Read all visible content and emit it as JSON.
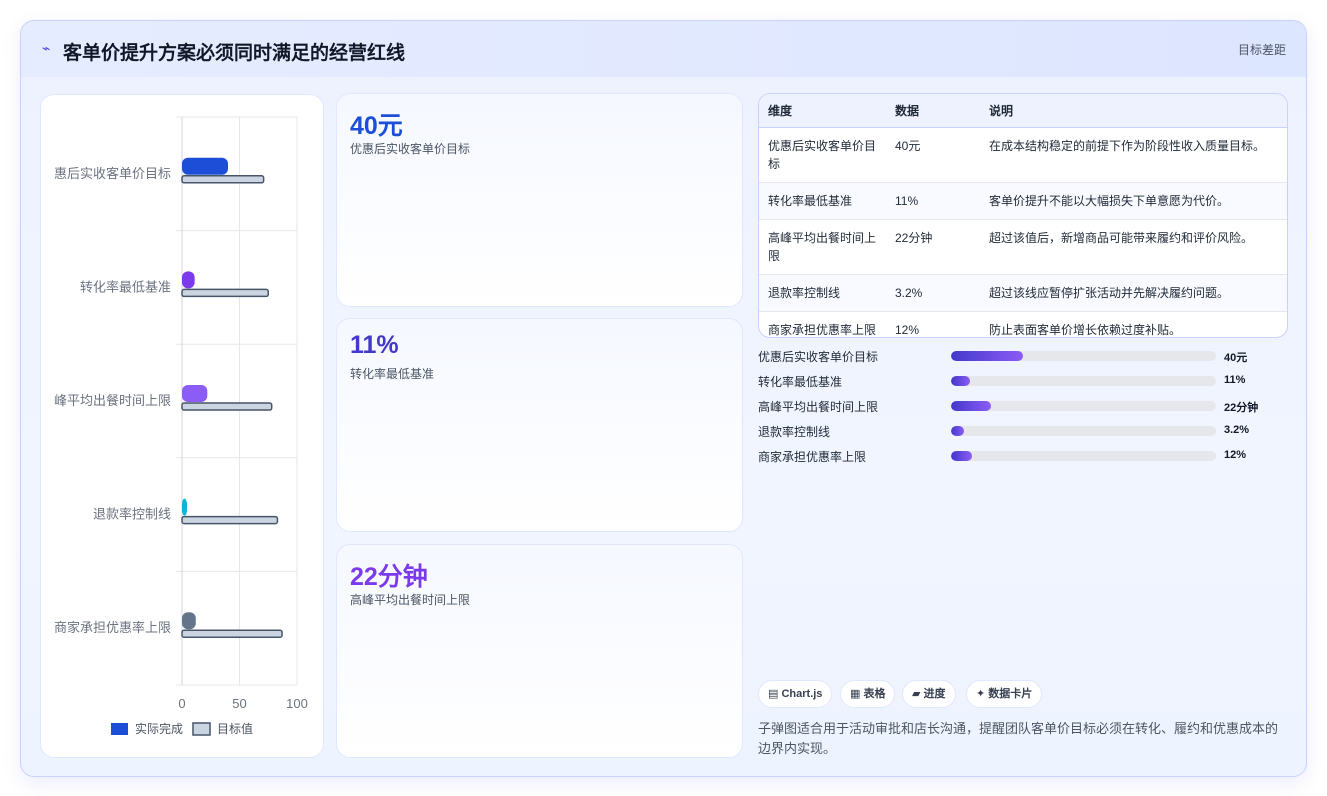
{
  "header": {
    "title": "客单价提升方案必须同时满足的经营红线",
    "tag": "目标差距"
  },
  "colors": {
    "accent": "#4f46e5",
    "blue": "#1d4ed8",
    "violet": "#7c3aed",
    "purple": "#8b5cf6",
    "cyan": "#06b6d4",
    "slate": "#64748b",
    "target": "#cbd5e1"
  },
  "chart_data": {
    "type": "bar",
    "orientation": "horizontal",
    "categories": [
      "惠后实收客单价目标",
      "转化率最低基准",
      "峰平均出餐时间上限",
      "退款率控制线",
      "商家承担优惠率上限"
    ],
    "series": [
      {
        "name": "实际完成",
        "values": [
          40,
          11,
          22,
          3.2,
          12
        ]
      },
      {
        "name": "目标值",
        "values": [
          71,
          75,
          78,
          83,
          87
        ]
      }
    ],
    "xlim": [
      0,
      100
    ],
    "xticks": [
      "0",
      "50",
      "100"
    ],
    "grid": true,
    "legend": "bottom"
  },
  "stats": [
    {
      "value": "40元",
      "label": "优惠后实收客单价目标",
      "color": "#1d4ed8"
    },
    {
      "value": "11%",
      "label": "转化率最低基准",
      "color": "#4338ca"
    },
    {
      "value": "22分钟",
      "label": "高峰平均出餐时间上限",
      "color": "#7c3aed"
    }
  ],
  "table": {
    "headers": [
      "维度",
      "数据",
      "说明"
    ],
    "rows": [
      [
        "优惠后实收客单价目标",
        "40元",
        "在成本结构稳定的前提下作为阶段性收入质量目标。"
      ],
      [
        "转化率最低基准",
        "11%",
        "客单价提升不能以大幅损失下单意愿为代价。"
      ],
      [
        "高峰平均出餐时间上限",
        "22分钟",
        "超过该值后，新增商品可能带来履约和评价风险。"
      ],
      [
        "退款率控制线",
        "3.2%",
        "超过该线应暂停扩张活动并先解决履约问题。"
      ],
      [
        "商家承担优惠率上限",
        "12%",
        "防止表面客单价增长依赖过度补贴。"
      ]
    ]
  },
  "progress": [
    {
      "label": "优惠后实收客单价目标",
      "value": "40元",
      "fraction": 0.27
    },
    {
      "label": "转化率最低基准",
      "value": "11%",
      "fraction": 0.07
    },
    {
      "label": "高峰平均出餐时间上限",
      "value": "22分钟",
      "fraction": 0.15
    },
    {
      "label": "退款率控制线",
      "value": "3.2%",
      "fraction": 0.05
    },
    {
      "label": "商家承担优惠率上限",
      "value": "12%",
      "fraction": 0.08
    }
  ],
  "chips": [
    {
      "icon": "chart-icon",
      "glyph": "▤",
      "label": "Chart.js"
    },
    {
      "icon": "table-icon",
      "glyph": "▦",
      "label": "表格"
    },
    {
      "icon": "progress-icon",
      "glyph": "▰",
      "label": "进度"
    },
    {
      "icon": "sparkle-icon",
      "glyph": "✦",
      "label": "数据卡片"
    }
  ],
  "note": "子弹图适合用于活动审批和店长沟通，提醒团队客单价目标必须在转化、履约和优惠成本的边界内实现。"
}
